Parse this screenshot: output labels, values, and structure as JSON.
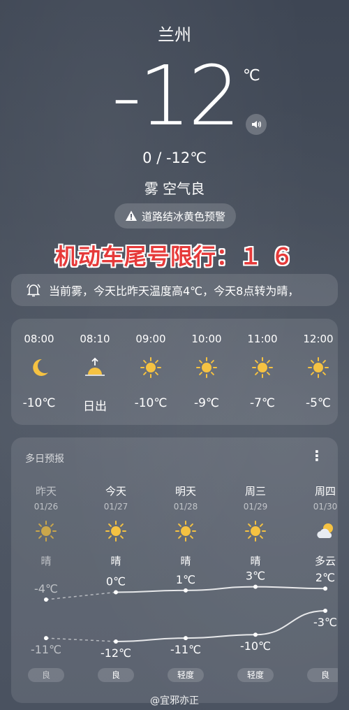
{
  "location": {
    "city": "兰州"
  },
  "current": {
    "temperature": "-12",
    "unit": "℃",
    "high_low": "0 / -12℃",
    "condition": "雾 空气良"
  },
  "warning": {
    "text": "道路结冰黄色预警",
    "icon": "warning-triangle-icon"
  },
  "restriction": {
    "text": "机动车尾号限行：１ ６"
  },
  "notice": {
    "text": "当前雾，今天比昨天温度高4℃，今天8点转为晴，",
    "icon": "bell-icon"
  },
  "hourly": [
    {
      "time": "08:00",
      "icon": "moon-icon",
      "temp": "-10℃"
    },
    {
      "time": "08:10",
      "icon": "sunrise-icon",
      "temp": "日出"
    },
    {
      "time": "09:00",
      "icon": "sun-icon",
      "temp": "-10℃"
    },
    {
      "time": "10:00",
      "icon": "sun-icon",
      "temp": "-9℃"
    },
    {
      "time": "11:00",
      "icon": "sun-icon",
      "temp": "-7℃"
    },
    {
      "time": "12:00",
      "icon": "sun-icon",
      "temp": "-5℃"
    }
  ],
  "daily": {
    "title": "多日预报",
    "more": "⋮",
    "days": [
      {
        "name": "昨天",
        "date": "01/26",
        "icon": "sun-icon",
        "condition": "晴",
        "high": "-4℃",
        "low": "-11℃",
        "air": "良",
        "high_value": -4,
        "low_value": -11
      },
      {
        "name": "今天",
        "date": "01/27",
        "icon": "sun-icon",
        "condition": "晴",
        "high": "0℃",
        "low": "-12℃",
        "air": "良",
        "high_value": 0,
        "low_value": -12
      },
      {
        "name": "明天",
        "date": "01/28",
        "icon": "sun-icon",
        "condition": "晴",
        "high": "1℃",
        "low": "-11℃",
        "air": "轻度",
        "high_value": 1,
        "low_value": -11
      },
      {
        "name": "周三",
        "date": "01/29",
        "icon": "sun-icon",
        "condition": "晴",
        "high": "3℃",
        "low": "-10℃",
        "air": "轻度",
        "high_value": 3,
        "low_value": -10
      },
      {
        "name": "周四",
        "date": "01/30",
        "icon": "partly-cloudy-icon",
        "condition": "多云",
        "high": "2℃",
        "low": "-3℃",
        "air": "良",
        "high_value": 2,
        "low_value": -3
      }
    ]
  },
  "watermark": {
    "text": "@宜邪亦正"
  },
  "colors": {
    "sun": "#f5c242",
    "restriction_text": "#e63a3a"
  }
}
